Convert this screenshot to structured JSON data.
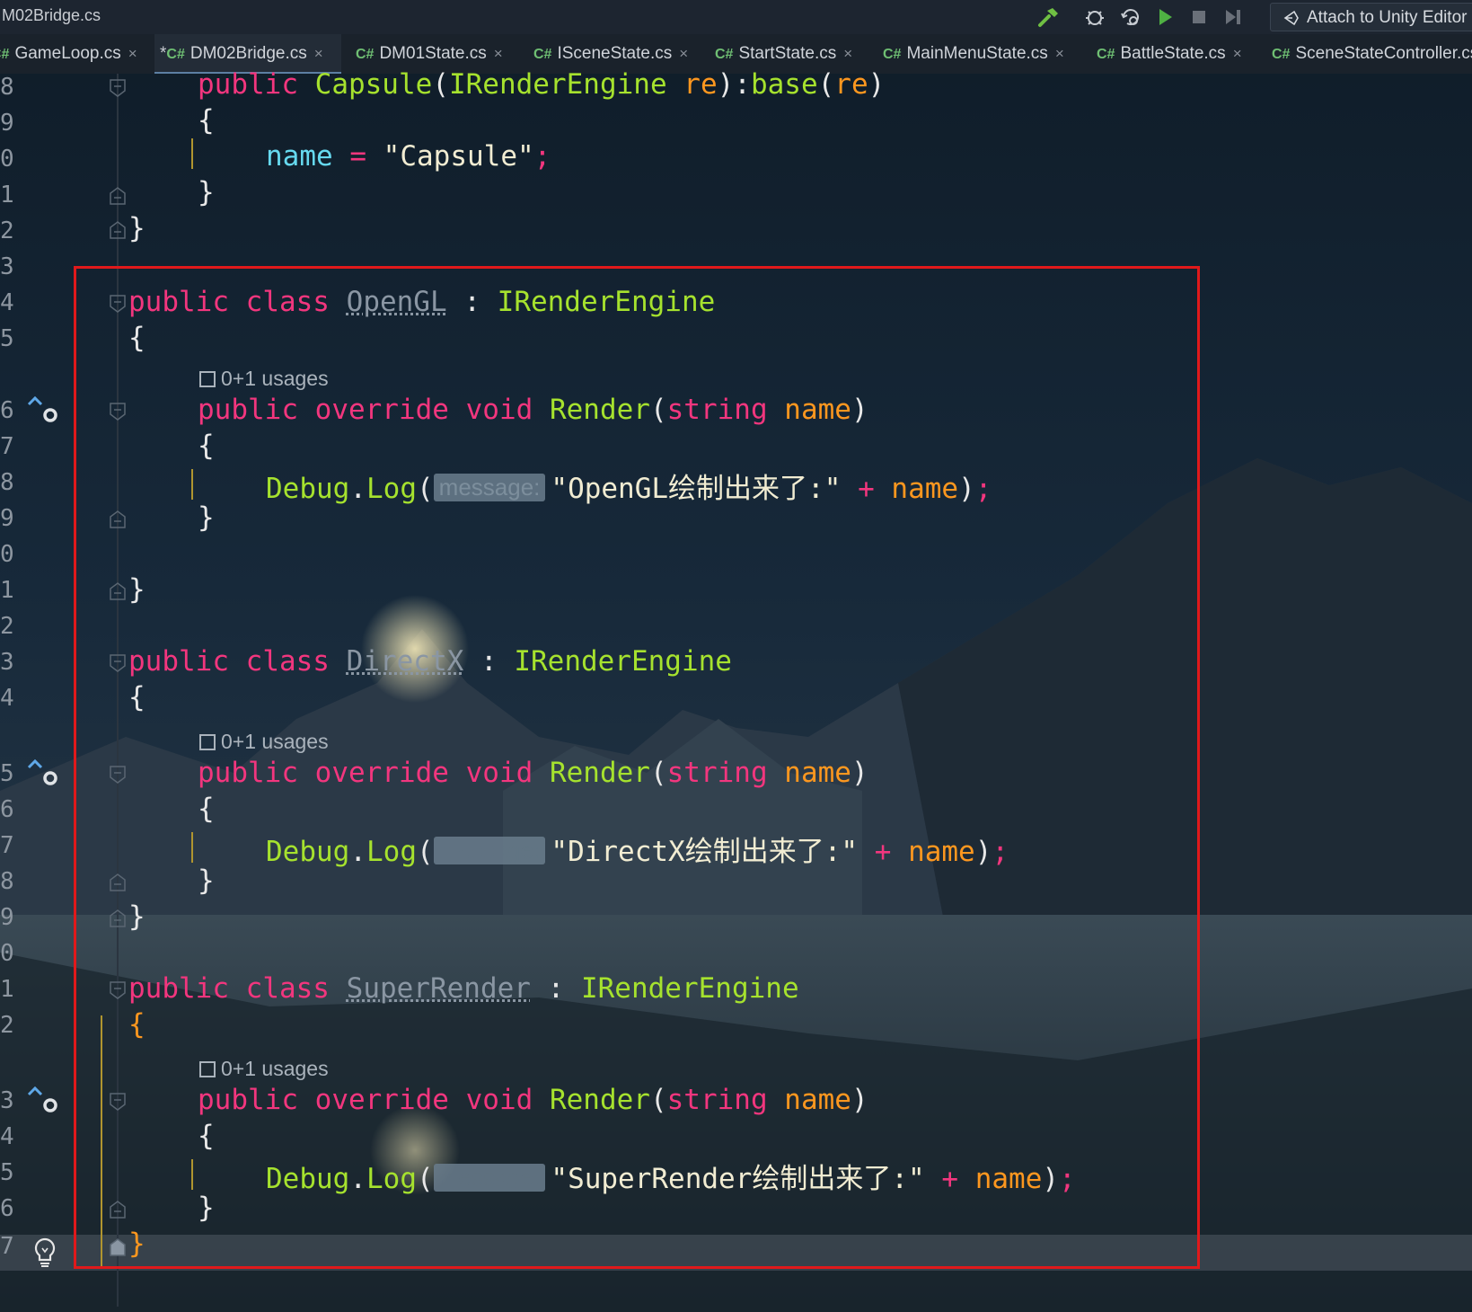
{
  "window": {
    "title": "M02Bridge.cs"
  },
  "toolbar": {
    "build_icon": "hammer-icon",
    "debug_icon": "bug-icon",
    "run_icon": "play-icon",
    "stop_icon": "stop-icon",
    "step_icon": "step-icon",
    "attach_label": "Attach to Unity Editor"
  },
  "tabs": [
    {
      "lang": "C#",
      "label": "GameLoop.cs",
      "modified": "",
      "close": "×"
    },
    {
      "lang": "C#",
      "label": "DM02Bridge.cs",
      "modified": "*",
      "close": "×",
      "active": true
    },
    {
      "lang": "C#",
      "label": "DM01State.cs",
      "modified": "",
      "close": "×"
    },
    {
      "lang": "C#",
      "label": "ISceneState.cs",
      "modified": "",
      "close": "×"
    },
    {
      "lang": "C#",
      "label": "StartState.cs",
      "modified": "",
      "close": "×"
    },
    {
      "lang": "C#",
      "label": "MainMenuState.cs",
      "modified": "",
      "close": "×"
    },
    {
      "lang": "C#",
      "label": "BattleState.cs",
      "modified": "",
      "close": "×"
    },
    {
      "lang": "C#",
      "label": "SceneStateController.cs",
      "modified": "",
      "close": ""
    }
  ],
  "editor": {
    "line_numbers": [
      "8",
      "9",
      "0",
      "1",
      "2",
      "3",
      "4",
      "5",
      "6",
      "7",
      "8",
      "9",
      "0",
      "1",
      "2",
      "3",
      "4",
      "5",
      "6",
      "7",
      "8",
      "9",
      "0",
      "1",
      "2",
      "3",
      "4",
      "5",
      "6",
      "7"
    ],
    "usages_label": "0+1 usages",
    "param_hint": "message:",
    "code": {
      "capsule_ctor": {
        "kw": "public",
        "name": "Capsule",
        "open": "(",
        "ptype": "IRenderEngine",
        "pname": "re",
        "mid": "):",
        "base": "base",
        "bopen": "(",
        "barg": "re",
        "close": ")"
      },
      "capsule_body": {
        "field": "name",
        "eq": "=",
        "value": "\"Capsule\"",
        "semi": ";"
      },
      "classes": [
        {
          "kw1": "public",
          "kw2": "class",
          "name": "OpenGL",
          "colon": ":",
          "iface": "IRenderEngine",
          "method": {
            "kw1": "public",
            "kw2": "override",
            "kw3": "void",
            "name": "Render",
            "ptype": "string",
            "pname": "name"
          },
          "log": {
            "obj": "Debug",
            "fn": "Log",
            "str": "\"OpenGL绘制出来了:\"",
            "plus": "+",
            "arg": "name"
          }
        },
        {
          "kw1": "public",
          "kw2": "class",
          "name": "DirectX",
          "colon": ":",
          "iface": "IRenderEngine",
          "method": {
            "kw1": "public",
            "kw2": "override",
            "kw3": "void",
            "name": "Render",
            "ptype": "string",
            "pname": "name"
          },
          "log": {
            "obj": "Debug",
            "fn": "Log",
            "str": "\"DirectX绘制出来了:\"",
            "plus": "+",
            "arg": "name"
          }
        },
        {
          "kw1": "public",
          "kw2": "class",
          "name": "SuperRender",
          "colon": ":",
          "iface": "IRenderEngine",
          "method": {
            "kw1": "public",
            "kw2": "override",
            "kw3": "void",
            "name": "Render",
            "ptype": "string",
            "pname": "name"
          },
          "log": {
            "obj": "Debug",
            "fn": "Log",
            "str": "\"SuperRender绘制出来了:\"",
            "plus": "+",
            "arg": "name"
          }
        }
      ],
      "open_brace": "{",
      "close_brace": "}"
    }
  },
  "colors": {
    "highlight_box": "#e0191b",
    "keyword": "#f2367e",
    "type": "#a6e22e",
    "param": "#fd971f"
  }
}
